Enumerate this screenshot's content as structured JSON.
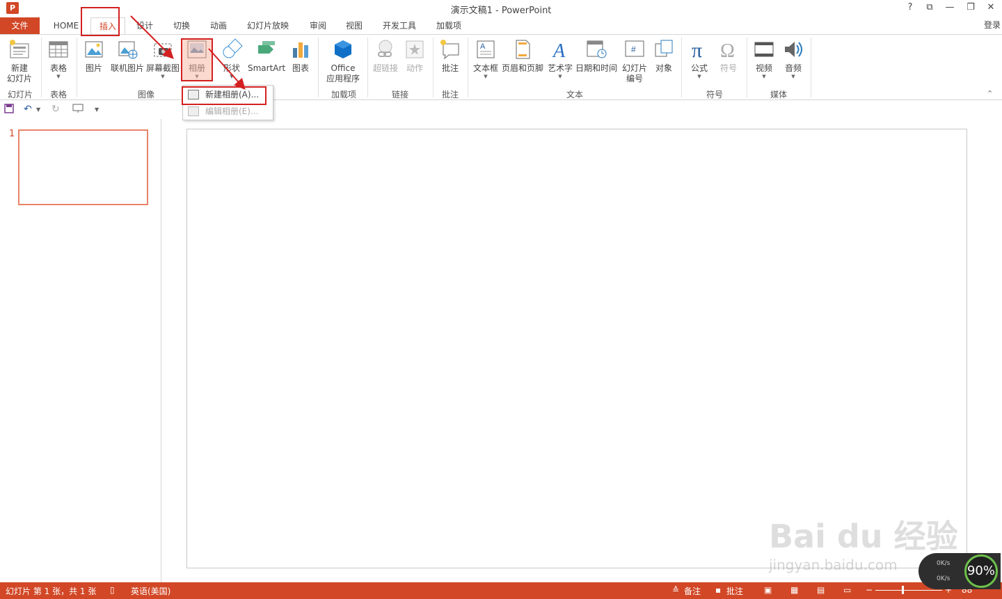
{
  "window": {
    "title": "演示文稿1 - PowerPoint",
    "logo": "P",
    "help": "?",
    "ribbon_display": "⧉",
    "minimize": "—",
    "restore": "❐",
    "close": "✕",
    "login": "登录"
  },
  "tabs": [
    {
      "label": "文件"
    },
    {
      "label": "HOME"
    },
    {
      "label": "插入"
    },
    {
      "label": "设计"
    },
    {
      "label": "切换"
    },
    {
      "label": "动画"
    },
    {
      "label": "幻灯片放映"
    },
    {
      "label": "审阅"
    },
    {
      "label": "视图"
    },
    {
      "label": "开发工具"
    },
    {
      "label": "加载项"
    }
  ],
  "ribbon": {
    "new_slide": "新建",
    "new_slide_2": "幻灯片",
    "table": "表格",
    "picture": "图片",
    "online_picture": "联机图片",
    "screenshot": "屏幕截图",
    "album": "相册",
    "shapes": "形状",
    "smartart": "SmartArt",
    "chart": "图表",
    "office_apps": "Office",
    "office_apps_2": "应用程序",
    "hyperlink": "超链接",
    "action": "动作",
    "comment": "批注",
    "textbox": "文本框",
    "header_footer": "页眉和页脚",
    "wordart": "艺术字",
    "datetime": "日期和时间",
    "slide_number": "幻灯片",
    "slide_number_2": "编号",
    "object": "对象",
    "equation": "公式",
    "symbol": "符号",
    "video": "视频",
    "audio": "音频",
    "groups": {
      "slides": "幻灯片",
      "tables": "表格",
      "images": "图像",
      "addins": "加载项",
      "links": "链接",
      "comments": "批注",
      "text": "文本",
      "symbols": "符号",
      "media": "媒体"
    }
  },
  "dropdown": {
    "new_album": "新建相册(A)...",
    "edit_album": "编辑相册(E)..."
  },
  "thumbnails": {
    "slide_number": "1"
  },
  "status": {
    "slide_info": "幻灯片 第 1 张，共 1 张",
    "language": "英语(美国)",
    "notes": "备注",
    "comments": "批注",
    "zoom": "88"
  },
  "watermark": {
    "brand": "Bai du 经验",
    "url": "jingyan.baidu.com"
  },
  "speed_widget": {
    "up": "0K/s",
    "down": "0K/s",
    "percent": "90%"
  }
}
